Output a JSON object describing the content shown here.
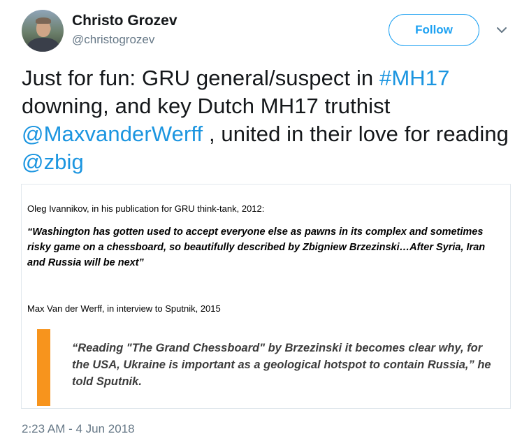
{
  "author": {
    "name": "Christo Grozev",
    "handle": "@christogrozev",
    "avatar_icon": "profile-photo"
  },
  "follow_label": "Follow",
  "more_icon": "chevron-down-icon",
  "tweet": {
    "part1": "Just for fun:  GRU general/suspect in ",
    "hashtag": "#MH17",
    "part2": " downing,  and key Dutch MH17 truthist ",
    "mention1": "@MaxvanderWerff",
    "part3": " , united in their love for reading ",
    "mention2": "@zbig"
  },
  "card": {
    "intro1": "Oleg Ivannikov, in his publication for GRU think-tank, 2012:",
    "quote1": "“Washington has gotten used to accept everyone else as pawns in its complex and sometimes risky game on a chessboard, so beautifully described by Zbigniew Brzezinski…After Syria, Iran and Russia will be next”",
    "intro2": "Max Van der Werff, in interview to Sputnik, 2015",
    "quote2": "“Reading \"The Grand Chessboard\" by Brzezinski it becomes clear why, for the USA, Ukraine is important as a geological hotspot to contain Russia,” he told Sputnik.",
    "bar_color": "#f7941d"
  },
  "timestamp": "2:23 AM - 4 Jun 2018",
  "colors": {
    "link": "#1b95e0",
    "follow": "#1da1f2",
    "muted": "#657786"
  }
}
